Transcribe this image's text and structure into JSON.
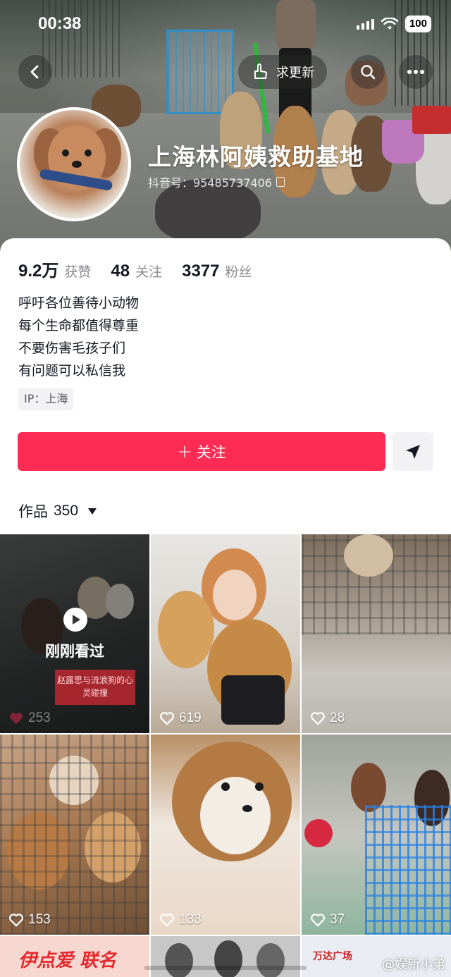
{
  "status_bar": {
    "time": "00:38",
    "battery": "100"
  },
  "header": {
    "update_label": "求更新",
    "name": "上海林阿姨救助基地",
    "douyin_id": "抖音号：95485737406"
  },
  "stats": [
    {
      "value": "9.2万",
      "label": "获赞"
    },
    {
      "value": "48",
      "label": "关注"
    },
    {
      "value": "3377",
      "label": "粉丝"
    }
  ],
  "bio": [
    "呼吁各位善待小动物",
    "每个生命都值得尊重",
    "不要伤害毛孩子们",
    "有问题可以私信我"
  ],
  "ip": "IP：上海",
  "actions": {
    "follow_label": "关注"
  },
  "works": {
    "label": "作品",
    "count": "350"
  },
  "videos": [
    {
      "likes": "253",
      "overlay": "刚刚看过",
      "banner": "赵露思与流浪狗的心灵碰撞"
    },
    {
      "likes": "619"
    },
    {
      "likes": "28"
    },
    {
      "likes": "153"
    },
    {
      "likes": "133"
    },
    {
      "likes": "37"
    },
    {
      "label": "伊点爱 联名"
    },
    {
      "label": ""
    },
    {
      "label": "万达广场"
    }
  ],
  "watermark": "@娱新小弟",
  "colors": {
    "accent": "#fe2c55",
    "text": "#161823",
    "muted": "#8a8b91"
  }
}
